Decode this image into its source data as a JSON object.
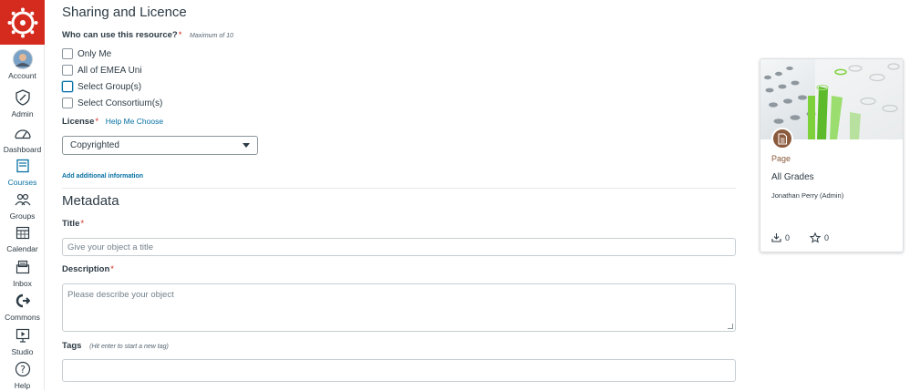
{
  "nav": {
    "items": [
      {
        "label": "Account",
        "icon": "avatar"
      },
      {
        "label": "Admin",
        "icon": "shield-icon"
      },
      {
        "label": "Dashboard",
        "icon": "dashboard-icon"
      },
      {
        "label": "Courses",
        "icon": "book-icon",
        "active": true
      },
      {
        "label": "Groups",
        "icon": "groups-icon"
      },
      {
        "label": "Calendar",
        "icon": "calendar-icon"
      },
      {
        "label": "Inbox",
        "icon": "inbox-icon"
      },
      {
        "label": "Commons",
        "icon": "commons-icon"
      },
      {
        "label": "Studio",
        "icon": "studio-icon"
      },
      {
        "label": "Help",
        "icon": "help-icon"
      }
    ],
    "active_color": "#0770a3",
    "brand_color": "#d52b1e"
  },
  "sharing": {
    "title": "Sharing and Licence",
    "who_label": "Who can use this resource?",
    "who_hint": "Maximum of 10",
    "options": [
      {
        "label": "Only Me",
        "checked": false
      },
      {
        "label": "All of EMEA Uni",
        "checked": false
      },
      {
        "label": "Select Group(s)",
        "checked": false,
        "focused": true
      },
      {
        "label": "Select Consortium(s)",
        "checked": false
      }
    ],
    "license_label": "License",
    "license_help": "Help Me Choose",
    "license_value": "Copyrighted",
    "add_info": "Add additional information"
  },
  "metadata": {
    "title": "Metadata",
    "title_label": "Title",
    "title_placeholder": "Give your object a title",
    "description_label": "Description",
    "description_placeholder": "Please describe your object",
    "tags_label": "Tags",
    "tags_hint": "(Hit enter to start a new tag)"
  },
  "card": {
    "type": "Page",
    "title": "All Grades",
    "author": "Jonathan Perry (Admin)",
    "downloads": "0",
    "favorites": "0",
    "type_color": "#8b5a3c"
  }
}
